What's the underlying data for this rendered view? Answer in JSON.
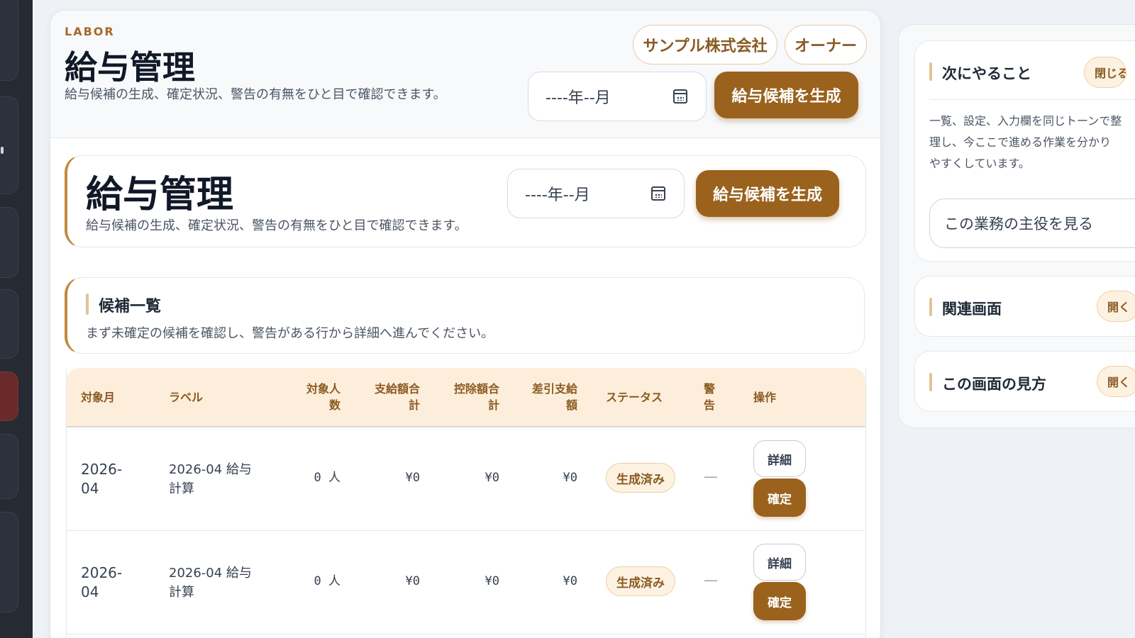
{
  "header": {
    "eyebrow": "LABOR",
    "title": "給与管理",
    "description": "給与候補の生成、確定状況、警告の有無をひと目で確認できます。",
    "company": "サンプル株式会社",
    "role": "オーナー",
    "month_placeholder": "----年--月",
    "generate_label": "給与候補を生成"
  },
  "page_card": {
    "title": "給与管理",
    "description": "給与候補の生成、確定状況、警告の有無をひと目で確認できます。",
    "month_placeholder": "----年--月",
    "generate_label": "給与候補を生成"
  },
  "candidates": {
    "title": "候補一覧",
    "description": "まず未確定の候補を確認し、警告がある行から詳細へ進んでください。",
    "columns": {
      "month": "対象月",
      "label": "ラベル",
      "headcount_1": "対象人",
      "headcount_2": "数",
      "pay_1": "支給額合",
      "pay_2": "計",
      "deduct_1": "控除額合",
      "deduct_2": "計",
      "net_1": "差引支給",
      "net_2": "額",
      "status": "ステータス",
      "warn_1": "警",
      "warn_2": "告",
      "actions": "操作"
    },
    "rows": [
      {
        "month_1": "2026-",
        "month_2": "04",
        "label_1": "2026-04 給与",
        "label_2": "計算",
        "headcount": "0 人",
        "pay": "¥0",
        "deduct": "¥0",
        "net": "¥0",
        "status": "生成済み",
        "warning": "—",
        "detail_label": "詳細",
        "confirm_label": "確定"
      },
      {
        "month_1": "2026-",
        "month_2": "04",
        "label_1": "2026-04 給与",
        "label_2": "計算",
        "headcount": "0 人",
        "pay": "¥0",
        "deduct": "¥0",
        "net": "¥0",
        "status": "生成済み",
        "warning": "—",
        "detail_label": "詳細",
        "confirm_label": "確定"
      }
    ]
  },
  "sidebar_right": {
    "next": {
      "title": "次にやること",
      "toggle": "閉じる",
      "desc_1": "一覧、設定、入力欄を同じトーンで整",
      "desc_2": "理し、今ここで進める作業を分かり",
      "desc_3": "やすくしています。",
      "button": "この業務の主役を見る"
    },
    "related": {
      "title": "関連画面",
      "toggle": "開く"
    },
    "howto": {
      "title": "この画面の見方",
      "toggle": "開く"
    }
  },
  "colors": {
    "accent": "#9a621d",
    "accent_light": "#fdeedb",
    "sidebar": "#262b33"
  }
}
